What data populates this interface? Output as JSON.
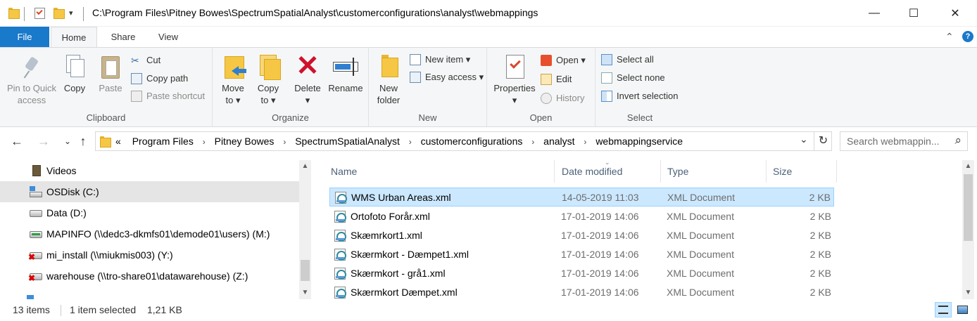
{
  "window": {
    "title": "C:\\Program Files\\Pitney Bowes\\SpectrumSpatialAnalyst\\customerconfigurations\\analyst\\webmappings",
    "minimize": "—",
    "maximize": "☐",
    "close": "✕"
  },
  "tabs": [
    {
      "label": "File"
    },
    {
      "label": "Home"
    },
    {
      "label": "Share"
    },
    {
      "label": "View"
    }
  ],
  "ribbon_toggle": "⌃",
  "help": "?",
  "ribbon": {
    "clipboard": {
      "label": "Clipboard",
      "pin": "Pin to Quick\naccess",
      "copy": "Copy",
      "paste": "Paste",
      "cut": "Cut",
      "copy_path": "Copy path",
      "paste_shortcut": "Paste shortcut"
    },
    "organize": {
      "label": "Organize",
      "move_to": "Move\nto ▾",
      "copy_to": "Copy\nto ▾",
      "delete": "Delete\n▾",
      "rename": "Rename"
    },
    "new": {
      "label": "New",
      "new_folder": "New\nfolder",
      "new_item": "New item ▾",
      "easy_access": "Easy access ▾"
    },
    "open": {
      "label": "Open",
      "properties": "Properties\n▾",
      "open": "Open ▾",
      "edit": "Edit",
      "history": "History"
    },
    "select": {
      "label": "Select",
      "select_all": "Select all",
      "select_none": "Select none",
      "invert": "Invert selection"
    }
  },
  "nav": {
    "back": "←",
    "forward": "→",
    "recent": "⌄",
    "up": "↑",
    "overflow": "«",
    "breadcrumbs": [
      "Program Files",
      "Pitney Bowes",
      "SpectrumSpatialAnalyst",
      "customerconfigurations",
      "analyst",
      "webmappingservice"
    ],
    "breadcrumb_sep": "›",
    "dropdown": "⌄",
    "refresh": "↻",
    "search_placeholder": "Search webmappin...",
    "search_icon": "⌕"
  },
  "navpane": {
    "items": [
      {
        "label": "Videos",
        "icon": "videos-icon"
      },
      {
        "label": "OSDisk (C:)",
        "icon": "os-drive-icon"
      },
      {
        "label": "Data (D:)",
        "icon": "drive-icon"
      },
      {
        "label": "MAPINFO (\\\\dedc3-dkmfs01\\demode01\\users) (M:)",
        "icon": "network-drive-icon"
      },
      {
        "label": "mi_install (\\\\miukmis003) (Y:)",
        "icon": "disconnected-drive-icon"
      },
      {
        "label": "warehouse (\\\\tro-share01\\datawarehouse) (Z:)",
        "icon": "disconnected-drive-icon"
      }
    ]
  },
  "filelist": {
    "columns": [
      "Name",
      "Date modified",
      "Type",
      "Size"
    ],
    "rows": [
      {
        "name": "WMS Urban Areas.xml",
        "date": "14-05-2019 11:03",
        "type": "XML Document",
        "size": "2 KB"
      },
      {
        "name": "Ortofoto Forår.xml",
        "date": "17-01-2019 14:06",
        "type": "XML Document",
        "size": "2 KB"
      },
      {
        "name": "Skæmrkort1.xml",
        "date": "17-01-2019 14:06",
        "type": "XML Document",
        "size": "2 KB"
      },
      {
        "name": "Skærmkort - Dæmpet1.xml",
        "date": "17-01-2019 14:06",
        "type": "XML Document",
        "size": "2 KB"
      },
      {
        "name": "Skærmkort - grå1.xml",
        "date": "17-01-2019 14:06",
        "type": "XML Document",
        "size": "2 KB"
      },
      {
        "name": "Skærmkort Dæmpet.xml",
        "date": "17-01-2019 14:06",
        "type": "XML Document",
        "size": "2 KB"
      }
    ]
  },
  "status": {
    "count": "13 items",
    "selected": "1 item selected",
    "size": "1,21 KB"
  },
  "colors": {
    "accent": "#1979ca",
    "selection": "#cce8ff"
  }
}
